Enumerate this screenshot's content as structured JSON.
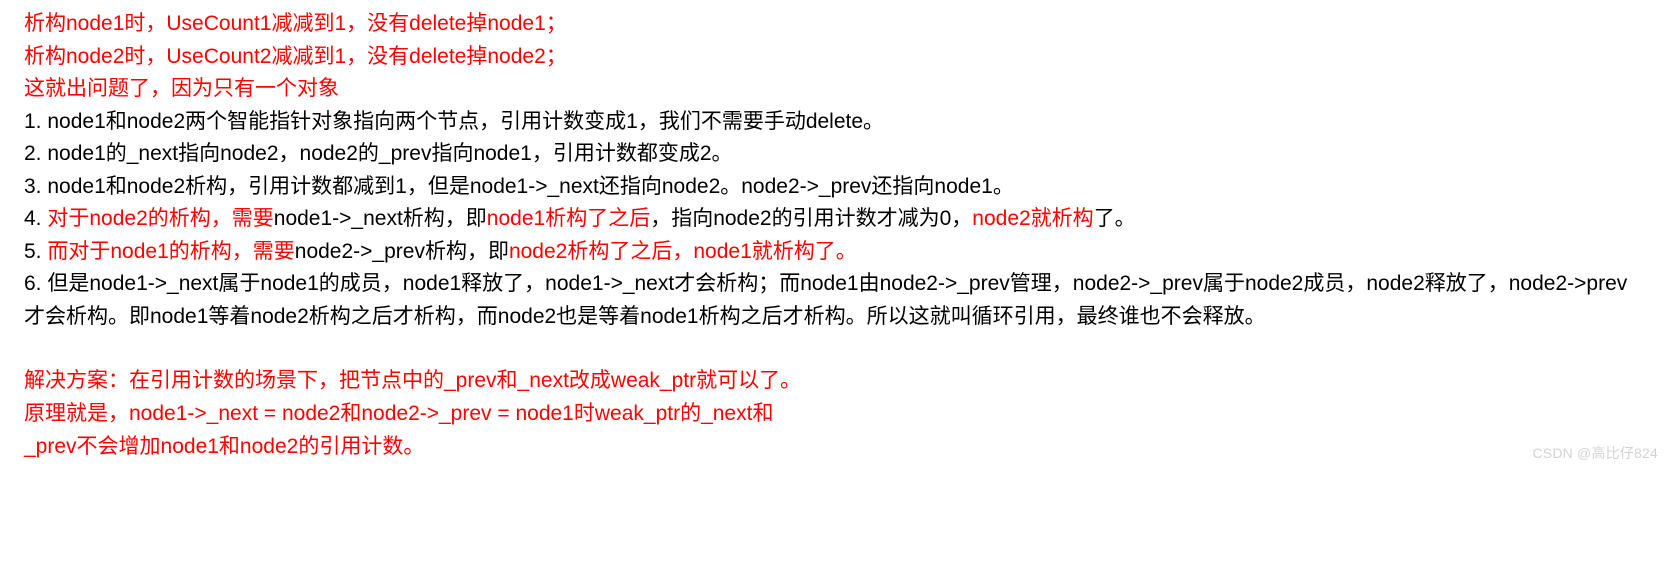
{
  "intro": {
    "line1": "析构node1时，UseCount1减减到1，没有delete掉node1；",
    "line2": "析构node2时，UseCount2减减到1，没有delete掉node2；",
    "line3": "这就出问题了，因为只有一个对象"
  },
  "list": {
    "item1": {
      "num": "1. ",
      "text": "node1和node2两个智能指针对象指向两个节点，引用计数变成1，我们不需要手动delete。"
    },
    "item2": {
      "num": "2. ",
      "text": "node1的_next指向node2，node2的_prev指向node1，引用计数都变成2。"
    },
    "item3": {
      "num": "3. ",
      "text": "node1和node2析构，引用计数都减到1，但是node1->_next还指向node2。node2->_prev还指向node1。"
    },
    "item4": {
      "num": "4. ",
      "p1": "对于node2的析构，需要",
      "p2": "node1->_next析构，即",
      "p3": "node1析构了之后",
      "p4": "，指向node2的引用计数才减为0，",
      "p5": "node2就析构",
      "p6": "了。"
    },
    "item5": {
      "num": "5. ",
      "p1": "而对于node1的析构，需要",
      "p2": "node2->_prev析构，即",
      "p3": "node2析构了之后，node1就析构了。"
    },
    "item6": {
      "num": "6. ",
      "text": "但是node1->_next属于node1的成员，node1释放了，node1->_next才会析构；而node1由node2->_prev管理，node2->_prev属于node2成员，node2释放了，node2->prev才会析构。即node1等着node2析构之后才析构，而node2也是等着node1析构之后才析构。所以这就叫循环引用，最终谁也不会释放。"
    }
  },
  "solution": {
    "line1": "解决方案：在引用计数的场景下，把节点中的_prev和_next改成weak_ptr就可以了。",
    "line2": "原理就是，node1->_next = node2和node2->_prev = node1时weak_ptr的_next和",
    "line3": "_prev不会增加node1和node2的引用计数。"
  },
  "watermark": "CSDN @高比仔824"
}
